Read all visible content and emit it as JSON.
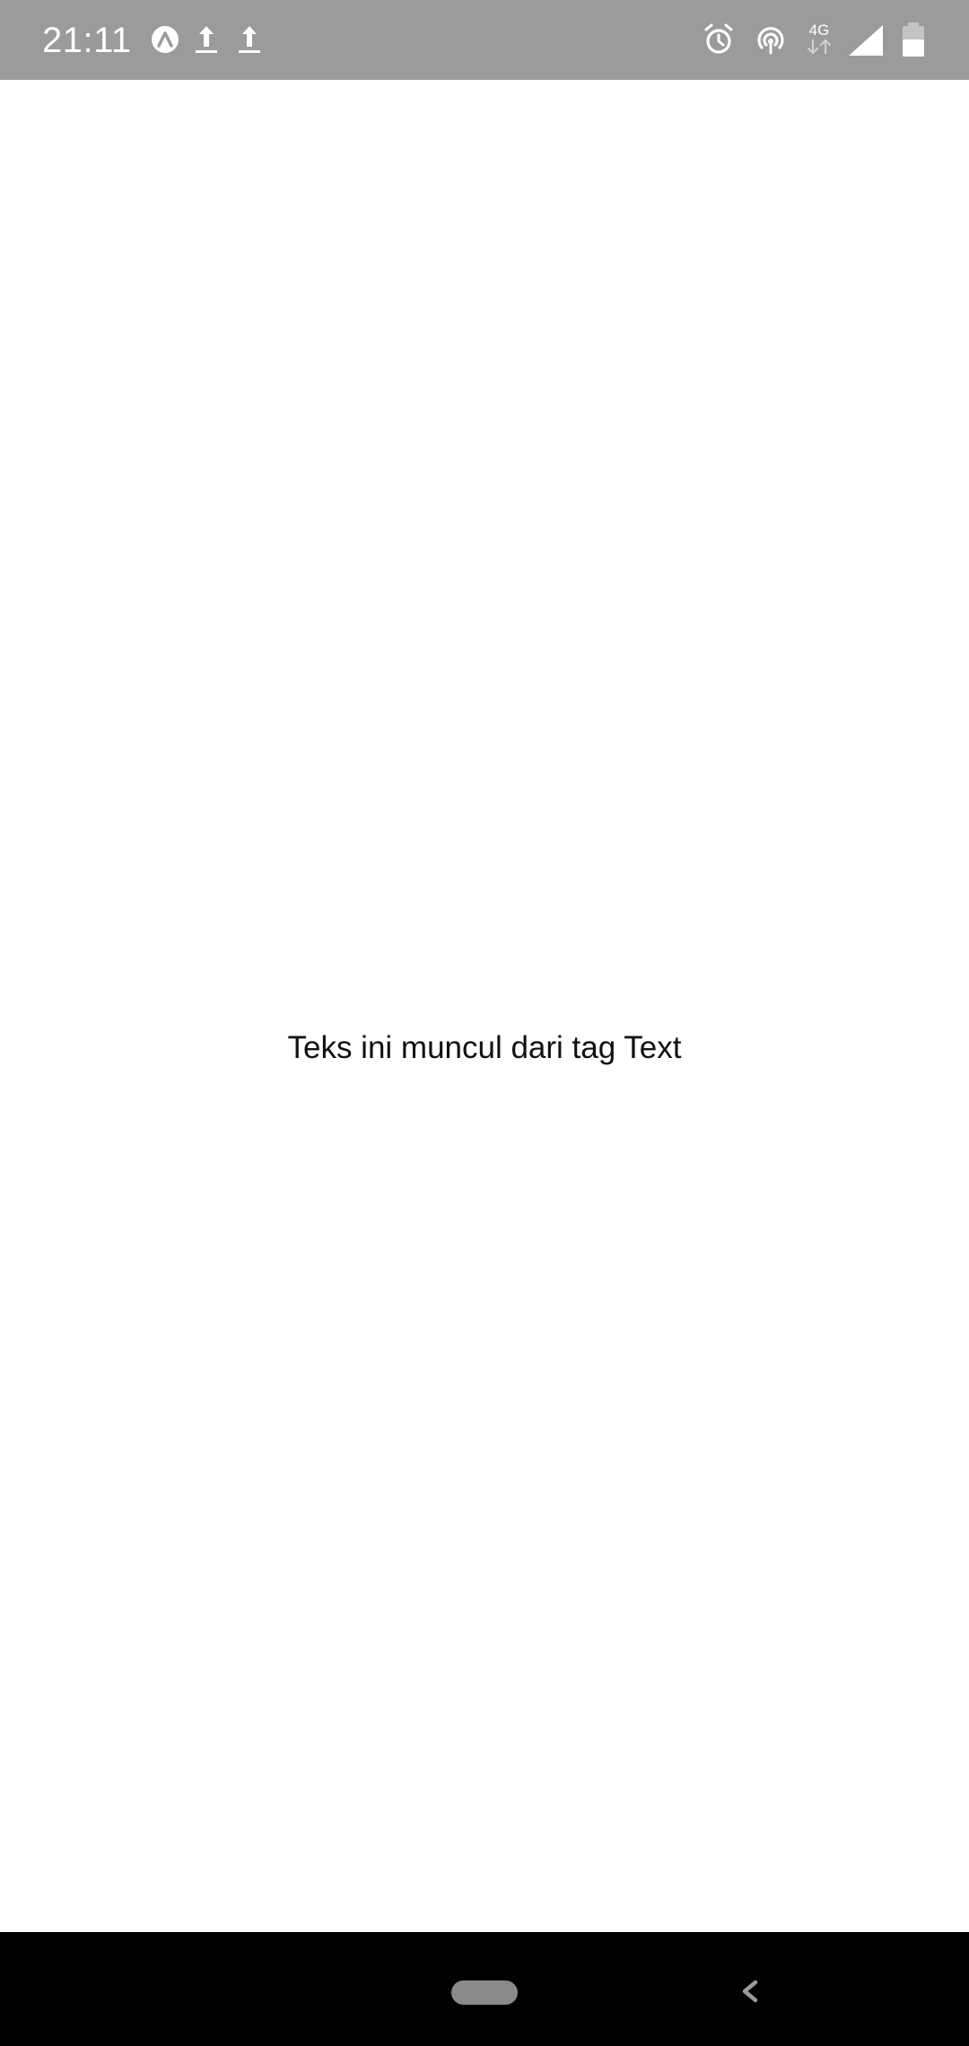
{
  "status_bar": {
    "time": "21:11",
    "network_type": "4G",
    "left_icons": [
      "app-notification-icon",
      "upload-icon",
      "upload-icon"
    ],
    "right_icons": [
      "alarm-icon",
      "hotspot-icon",
      "mobile-data-icon",
      "cellular-signal-icon",
      "battery-icon"
    ]
  },
  "main": {
    "text": "Teks ini muncul dari tag Text"
  },
  "navigation": {
    "home_label": "home",
    "back_label": "back"
  }
}
